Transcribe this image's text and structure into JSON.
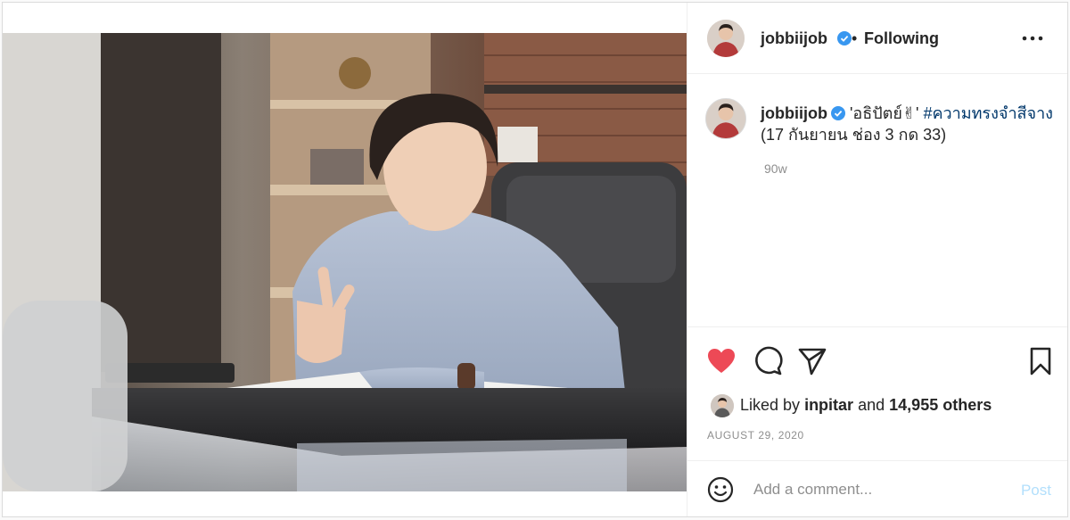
{
  "post": {
    "username": "jobbiijob",
    "separator": "•",
    "follow_status": "Following",
    "caption_quote": "'อธิปัตย์✌'",
    "caption_hashtag": "#ความทรงจำสีจาง",
    "caption_line2": "(17 กันยายน ช่อง 3 กด 33)",
    "time_ago": "90w",
    "liked_by_prefix": "Liked by",
    "liked_by_user": "inpitar",
    "liked_by_and": "and",
    "liked_by_others": "14,955 others",
    "date": "AUGUST 29, 2020",
    "comment_placeholder": "Add a comment...",
    "post_label": "Post"
  },
  "icons": {
    "verified": "verified-badge-icon",
    "more": "more-options-icon",
    "like": "heart-icon",
    "comment": "comment-icon",
    "share": "share-icon",
    "save": "bookmark-icon",
    "emoji": "emoji-icon"
  },
  "colors": {
    "like_red": "#ed4956",
    "verified_blue": "#3897f0",
    "hashtag_blue": "#00376b",
    "post_disabled": "#b2dffc",
    "muted": "#8e8e8e"
  }
}
